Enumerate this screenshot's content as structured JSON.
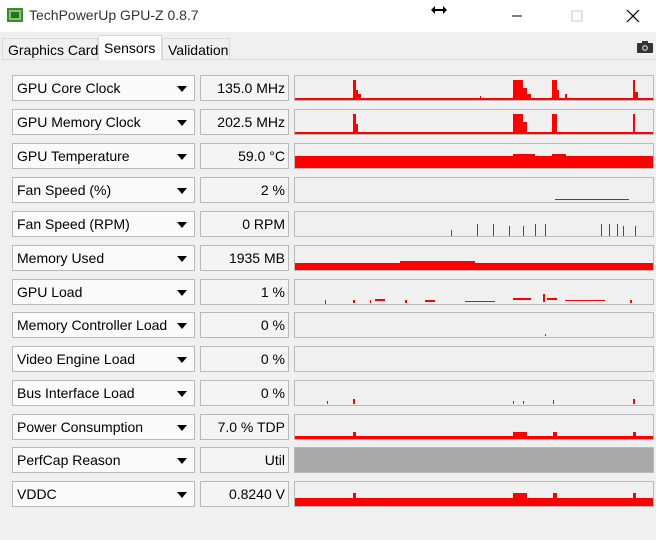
{
  "window": {
    "title": "TechPowerUp GPU-Z 0.8.7",
    "icons": [
      "gpu-z-app-icon",
      "resize-icon",
      "minimize-icon",
      "maximize-icon",
      "close-icon"
    ]
  },
  "tabs": [
    {
      "label": "Graphics Card",
      "active": false
    },
    {
      "label": "Sensors",
      "active": true
    },
    {
      "label": "Validation",
      "active": false
    }
  ],
  "colors": {
    "graph_fill": "#ff0000",
    "graph_background": "#f0f0f0",
    "graph_disabled": "#a9a9a9"
  },
  "sensors": [
    {
      "name": "GPU Core Clock",
      "value": "135.0 MHz"
    },
    {
      "name": "GPU Memory Clock",
      "value": "202.5 MHz"
    },
    {
      "name": "GPU Temperature",
      "value": "59.0 °C"
    },
    {
      "name": "Fan Speed (%)",
      "value": "2 %"
    },
    {
      "name": "Fan Speed (RPM)",
      "value": "0 RPM"
    },
    {
      "name": "Memory Used",
      "value": "1935 MB"
    },
    {
      "name": "GPU Load",
      "value": "1 %"
    },
    {
      "name": "Memory Controller Load",
      "value": "0 %"
    },
    {
      "name": "Video Engine Load",
      "value": "0 %"
    },
    {
      "name": "Bus Interface Load",
      "value": "0 %"
    },
    {
      "name": "Power Consumption",
      "value": "7.0 % TDP"
    },
    {
      "name": "PerfCap Reason",
      "value": "Util"
    },
    {
      "name": "VDDC",
      "value": "0.8240 V"
    }
  ]
}
